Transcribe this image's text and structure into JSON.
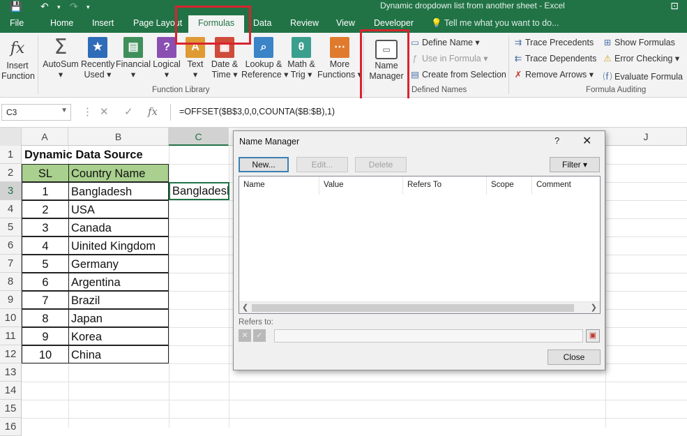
{
  "window": {
    "title": "Dynamic dropdown list from another sheet - Excel"
  },
  "tabs": [
    "File",
    "Home",
    "Insert",
    "Page Layout",
    "Formulas",
    "Data",
    "Review",
    "View",
    "Developer"
  ],
  "tell_me": "Tell me what you want to do...",
  "ribbon": {
    "insert_function": [
      "Insert",
      "Function"
    ],
    "library": [
      {
        "label1": "AutoSum",
        "label2": "▾",
        "icon": "sigma-icon",
        "color": "#555555"
      },
      {
        "label1": "Recently",
        "label2": "Used ▾",
        "icon": "star-icon",
        "color": "#2e6bb8"
      },
      {
        "label1": "Financial",
        "label2": "▾",
        "icon": "financial-icon",
        "color": "#3f8f5a"
      },
      {
        "label1": "Logical",
        "label2": "▾",
        "icon": "question-icon",
        "color": "#8a4fb3"
      },
      {
        "label1": "Text",
        "label2": "▾",
        "icon": "text-icon",
        "color": "#e09a34"
      },
      {
        "label1": "Date &",
        "label2": "Time ▾",
        "icon": "calendar-icon",
        "color": "#cf4b3a"
      },
      {
        "label1": "Lookup &",
        "label2": "Reference ▾",
        "icon": "magnifier-icon",
        "color": "#3a84c7"
      },
      {
        "label1": "Math &",
        "label2": "Trig ▾",
        "icon": "theta-icon",
        "color": "#3a9f8c"
      },
      {
        "label1": "More",
        "label2": "Functions ▾",
        "icon": "more-icon",
        "color": "#e07b2e"
      }
    ],
    "function_library_label": "Function Library",
    "name_manager": [
      "Name",
      "Manager"
    ],
    "define_name": "Define Name",
    "use_in_formula": "Use in Formula",
    "create_from_selection": "Create from Selection",
    "defined_names_label": "Defined Names",
    "trace_precedents": "Trace Precedents",
    "trace_dependents": "Trace Dependents",
    "remove_arrows": "Remove Arrows",
    "show_formulas": "Show Formulas",
    "error_checking": "Error Checking",
    "evaluate_formula": "Evaluate Formula",
    "formula_auditing_label": "Formula Auditing"
  },
  "formula_bar": {
    "name_box": "C3",
    "formula": "=OFFSET($B$3,0,0,COUNTA($B:$B),1)"
  },
  "columns": [
    "A",
    "B",
    "C",
    "J"
  ],
  "rows": [
    "1",
    "2",
    "3",
    "4",
    "5",
    "6",
    "7",
    "8",
    "9",
    "10",
    "11",
    "12",
    "13",
    "14",
    "15",
    "16"
  ],
  "sheet": {
    "title": "Dynamic Data Source",
    "header_sl": "SL",
    "header_country": "Country Name",
    "data": [
      {
        "sl": "1",
        "country": "Bangladesh"
      },
      {
        "sl": "2",
        "country": "USA"
      },
      {
        "sl": "3",
        "country": "Canada"
      },
      {
        "sl": "4",
        "country": "Uinited Kingdom"
      },
      {
        "sl": "5",
        "country": "Germany"
      },
      {
        "sl": "6",
        "country": "Argentina"
      },
      {
        "sl": "7",
        "country": "Brazil"
      },
      {
        "sl": "8",
        "country": "Japan"
      },
      {
        "sl": "9",
        "country": "Korea"
      },
      {
        "sl": "10",
        "country": "China"
      }
    ],
    "c3_value": "Bangladesh"
  },
  "dialog": {
    "title": "Name Manager",
    "help": "?",
    "close_x": "✕",
    "new_btn": "New...",
    "edit_btn": "Edit...",
    "delete_btn": "Delete",
    "filter_btn": "Filter ▾",
    "columns": [
      "Name",
      "Value",
      "Refers To",
      "Scope",
      "Comment"
    ],
    "refers_to_label": "Refers to:",
    "close_btn": "Close"
  }
}
